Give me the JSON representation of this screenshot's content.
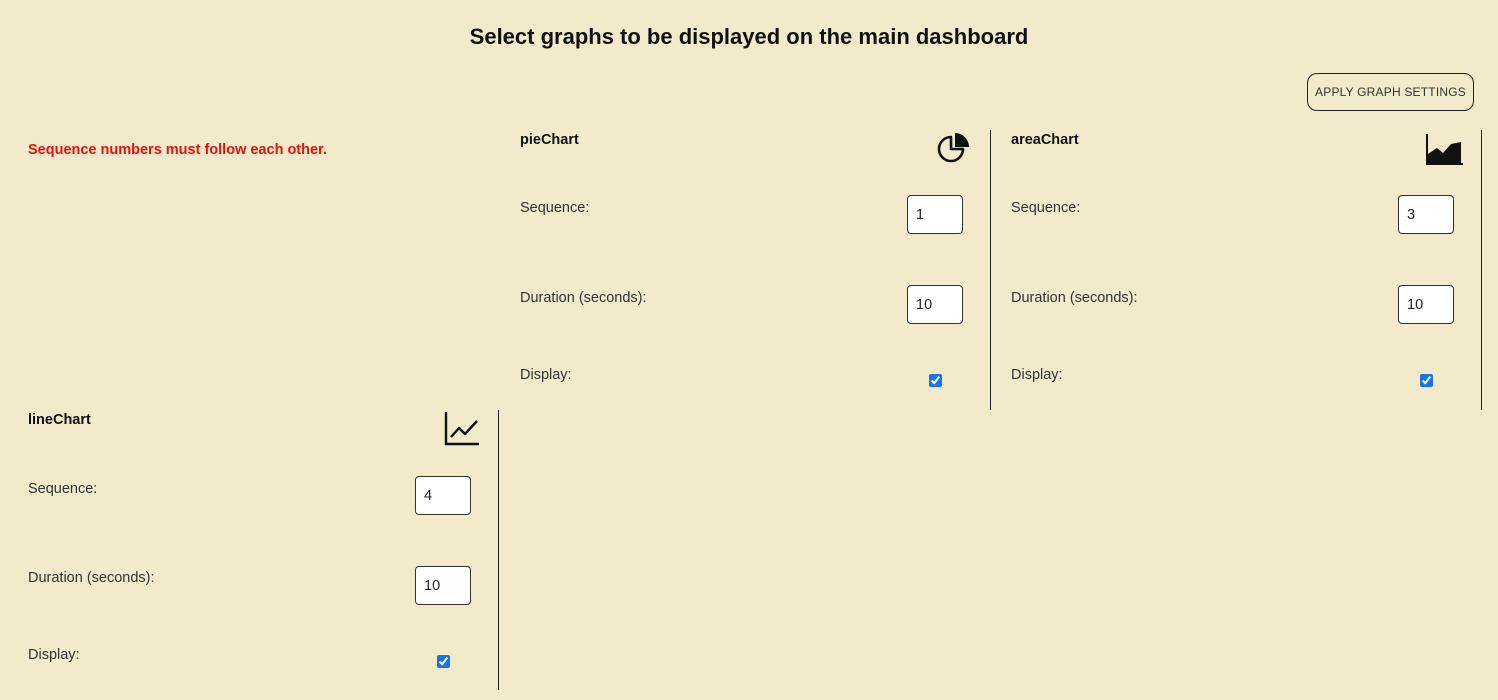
{
  "header": {
    "title": "Select graphs to be displayed on the main dashboard",
    "apply_label": "APPLY GRAPH SETTINGS"
  },
  "error": {
    "message": "Sequence numbers must follow each other.",
    "color": "#e0140f"
  },
  "colors": {
    "background": "#f3e9cb",
    "checkbox_accent": "#1a73e8"
  },
  "labels": {
    "sequence": "Sequence:",
    "duration": "Duration (seconds):",
    "display": "Display:"
  },
  "graphs": [
    {
      "name": "pieChart",
      "icon": "pie-chart-icon",
      "sequence": "1",
      "duration": "10",
      "display": true
    },
    {
      "name": "areaChart",
      "icon": "area-chart-icon",
      "sequence": "3",
      "duration": "10",
      "display": true
    },
    {
      "name": "lineChart",
      "icon": "line-chart-icon",
      "sequence": "4",
      "duration": "10",
      "display": true
    }
  ]
}
